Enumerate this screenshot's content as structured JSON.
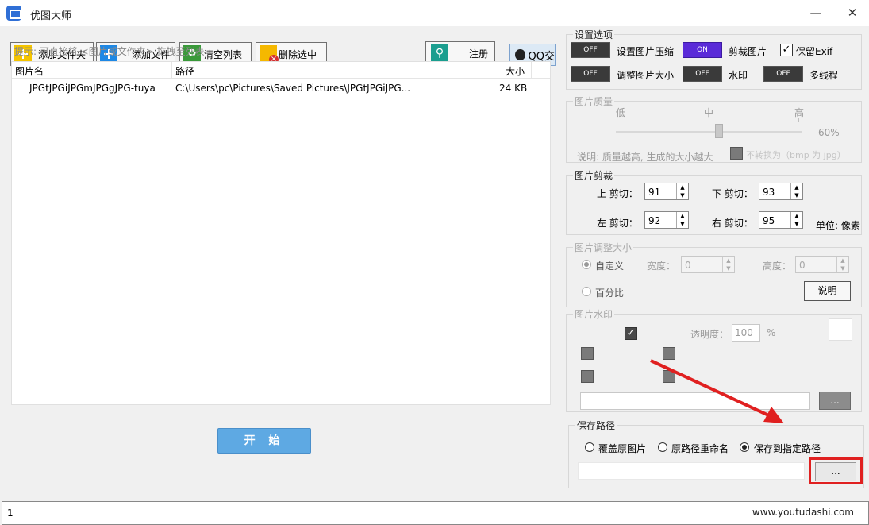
{
  "window": {
    "title": "优图大师",
    "minimize": "—",
    "close": "✕"
  },
  "toolbar": {
    "add_folder": "添加文件夹",
    "add_file": "添加文件",
    "clear_list": "清空列表",
    "delete_selected": "删除选中",
    "register": "注册",
    "qq": "QQ交"
  },
  "hint": "提示: 可直接将 <图片或文件夹> 拖拽至列表",
  "file_list": {
    "columns": [
      "图片名",
      "路径",
      "大小"
    ],
    "rows": [
      {
        "name": "JPGtJPGiJPGmJPGgJPG-tuya",
        "path": "C:\\Users\\pc\\Pictures\\Saved Pictures\\JPGtJPGiJPG...",
        "size": "24 KB"
      }
    ]
  },
  "start_button": "开 始",
  "status": {
    "left": "1",
    "watermark": "www.youtudashi.com"
  },
  "settings": {
    "title": "设置选项",
    "compress": {
      "label": "设置图片压缩",
      "state": "OFF"
    },
    "crop": {
      "label": "剪裁图片",
      "state": "ON"
    },
    "exif": {
      "label": "保留Exif",
      "checked": true
    },
    "resize": {
      "label": "调整图片大小",
      "state": "OFF"
    },
    "watermark": {
      "label": "水印",
      "state": "OFF"
    },
    "multithread": {
      "label": "多线程",
      "state": "OFF"
    }
  },
  "quality": {
    "title": "图片质量",
    "low": "低",
    "mid": "中",
    "high": "高",
    "value_label": "60%",
    "value": 0.6,
    "note": "说明: 质量越高, 生成的大小越大",
    "bmp_label": "不转换为（bmp 为 jpg）"
  },
  "crop": {
    "title": "图片剪裁",
    "top": {
      "label": "上 剪切：",
      "value": "91"
    },
    "bottom": {
      "label": "下 剪切：",
      "value": "93"
    },
    "left": {
      "label": "左 剪切：",
      "value": "92"
    },
    "right": {
      "label": "右 剪切：",
      "value": "95"
    },
    "unit": "单位: 像素"
  },
  "resize": {
    "title": "图片调整大小",
    "custom": "自定义",
    "width_label": "宽度：",
    "width_value": "0",
    "height_label": "高度：",
    "height_value": "0",
    "percent": "百分比",
    "explain_button": "说明"
  },
  "watermark": {
    "title": "图片水印",
    "opacity_label": "透明度：",
    "opacity_value": "100",
    "opacity_unit": "%",
    "browse": "..."
  },
  "save_path": {
    "title": "保存路径",
    "overwrite": "覆盖原图片",
    "rename": "原路径重命名",
    "custom": "保存到指定路径",
    "browse": "..."
  },
  "colors": {
    "accent_on": "#5a2bd8",
    "start": "#5ea9e3",
    "highlight": "#e02020"
  }
}
